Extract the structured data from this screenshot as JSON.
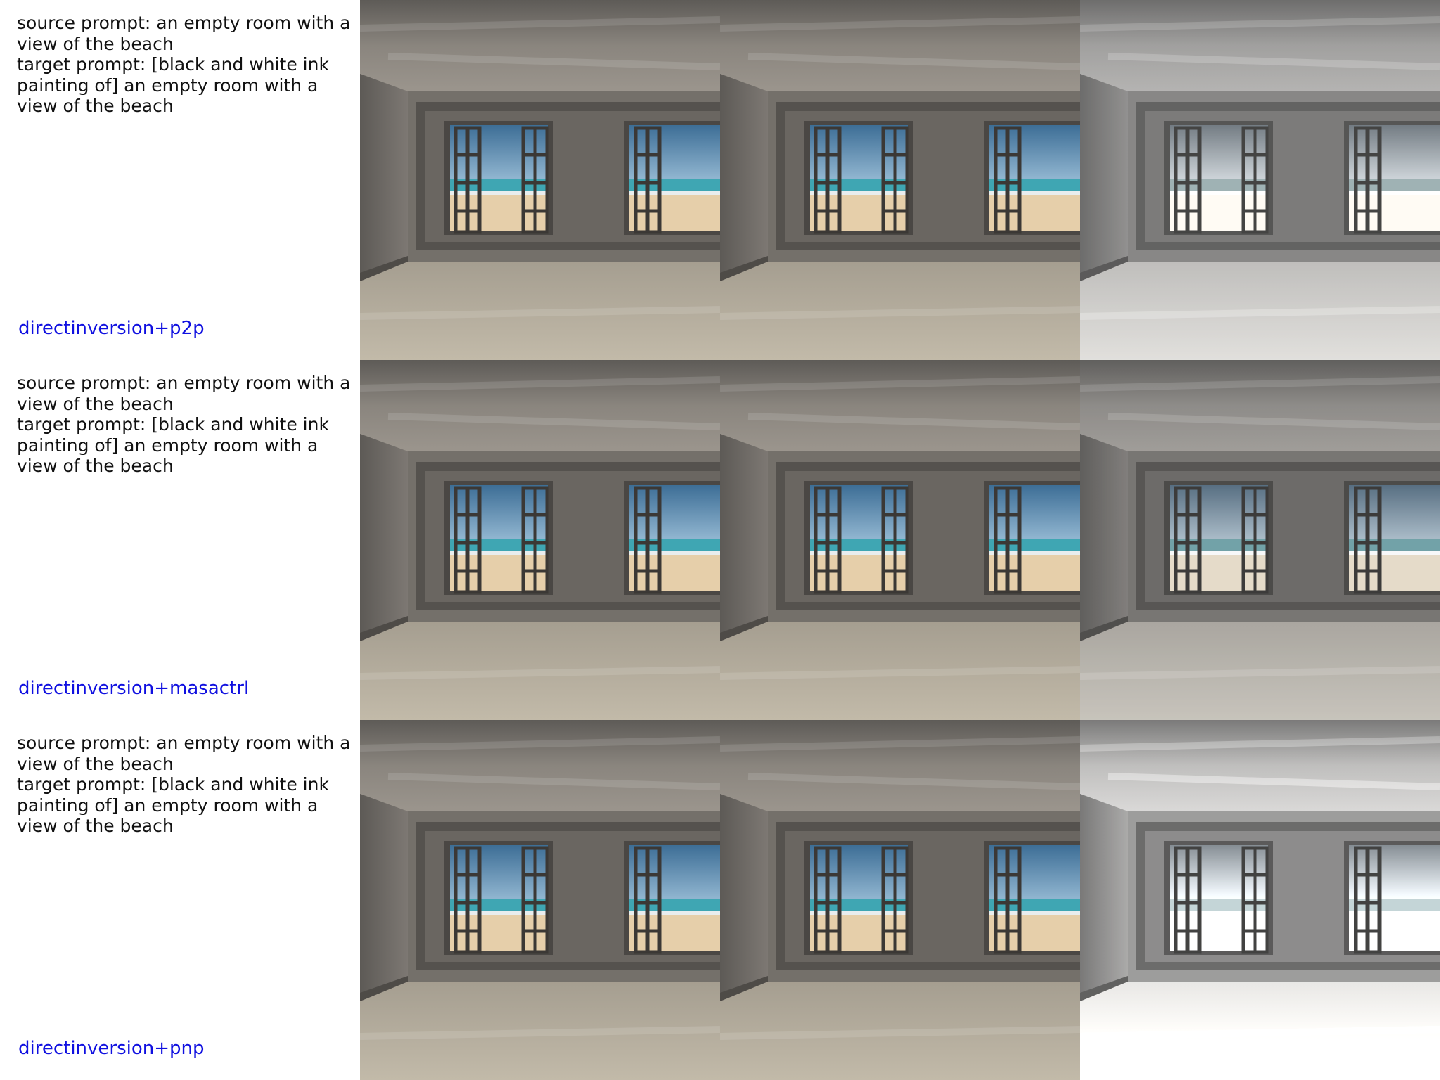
{
  "rows": [
    {
      "source_prompt": "source prompt: an empty room with a view of the beach",
      "target_prompt": "target prompt: [black and white ink painting of] an empty room with a view of the beach",
      "method": "directinversion+p2p"
    },
    {
      "source_prompt": "source prompt: an empty room with a view of the beach",
      "target_prompt": "target prompt: [black and white ink painting of] an empty room with a view of the beach",
      "method": "directinversion+masactrl"
    },
    {
      "source_prompt": "source prompt: an empty room with a view of the beach",
      "target_prompt": "target prompt: [black and white ink painting of] an empty room with a view of the beach",
      "method": "directinversion+pnp"
    }
  ],
  "colors": {
    "method_label": "#1010e0",
    "wall": "#6f6b66",
    "ceiling": "#86827c",
    "floor": "#b9b1a0",
    "sand": "#e6cfaa",
    "sea": "#3fa6b3",
    "sky": "#5d92b8"
  }
}
